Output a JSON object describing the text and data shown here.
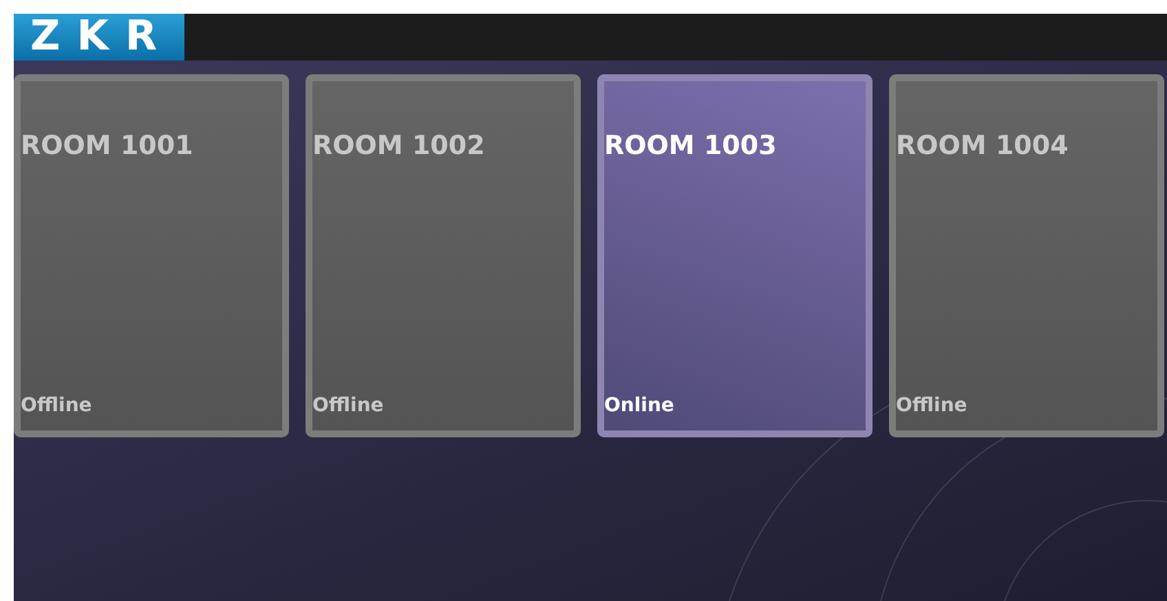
{
  "logo": "ZKR",
  "rooms": [
    {
      "name": "ROOM 1001",
      "status": "Offline",
      "online": false
    },
    {
      "name": "ROOM 1002",
      "status": "Offline",
      "online": false
    },
    {
      "name": "ROOM 1003",
      "status": "Online",
      "online": true
    },
    {
      "name": "ROOM 1004",
      "status": "Offline",
      "online": false
    }
  ]
}
